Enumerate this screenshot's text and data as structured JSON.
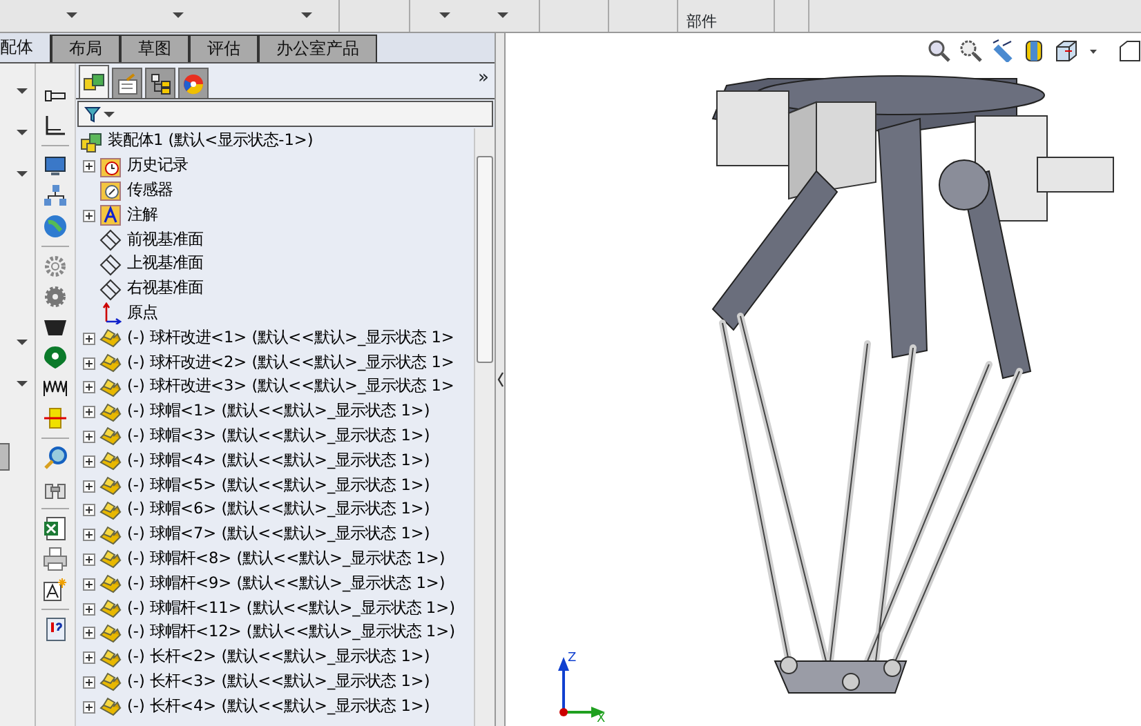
{
  "top_toolbar": {
    "label": "部件"
  },
  "tabs": [
    {
      "label": "配体",
      "selected": true
    },
    {
      "label": "布局",
      "selected": false
    },
    {
      "label": "草图",
      "selected": false
    },
    {
      "label": "评估",
      "selected": false
    },
    {
      "label": "办公室产品",
      "selected": false
    }
  ],
  "panel_tabs": [
    {
      "kind": "tree",
      "selected": true
    },
    {
      "kind": "property",
      "selected": false
    },
    {
      "kind": "config",
      "selected": false
    },
    {
      "kind": "appearance",
      "selected": false
    }
  ],
  "panel_more": "»",
  "tree": {
    "root": {
      "kind": "assembly",
      "label": "装配体1 (默认<显示状态-1>)"
    },
    "items": [
      {
        "kind": "history",
        "label": "历史记录",
        "collapsible": true
      },
      {
        "kind": "sensor",
        "label": "传感器",
        "collapsible": false
      },
      {
        "kind": "annotation",
        "label": "注解",
        "collapsible": true
      },
      {
        "kind": "plane",
        "label": "前视基准面",
        "collapsible": false
      },
      {
        "kind": "plane",
        "label": "上视基准面",
        "collapsible": false
      },
      {
        "kind": "plane",
        "label": "右视基准面",
        "collapsible": false
      },
      {
        "kind": "origin",
        "label": "原点",
        "collapsible": false
      },
      {
        "kind": "part",
        "label": "(-) 球杆改进<1> (默认<<默认>_显示状态 1>",
        "collapsible": true
      },
      {
        "kind": "part",
        "label": "(-) 球杆改进<2> (默认<<默认>_显示状态 1>",
        "collapsible": true
      },
      {
        "kind": "part",
        "label": "(-) 球杆改进<3> (默认<<默认>_显示状态 1>",
        "collapsible": true
      },
      {
        "kind": "part",
        "label": "(-) 球帽<1> (默认<<默认>_显示状态 1>)",
        "collapsible": true
      },
      {
        "kind": "part",
        "label": "(-) 球帽<3> (默认<<默认>_显示状态 1>)",
        "collapsible": true
      },
      {
        "kind": "part",
        "label": "(-) 球帽<4> (默认<<默认>_显示状态 1>)",
        "collapsible": true
      },
      {
        "kind": "part",
        "label": "(-) 球帽<5> (默认<<默认>_显示状态 1>)",
        "collapsible": true
      },
      {
        "kind": "part",
        "label": "(-) 球帽<6> (默认<<默认>_显示状态 1>)",
        "collapsible": true
      },
      {
        "kind": "part",
        "label": "(-) 球帽<7> (默认<<默认>_显示状态 1>)",
        "collapsible": true
      },
      {
        "kind": "part",
        "label": "(-) 球帽杆<8> (默认<<默认>_显示状态 1>)",
        "collapsible": true
      },
      {
        "kind": "part",
        "label": "(-) 球帽杆<9> (默认<<默认>_显示状态 1>)",
        "collapsible": true
      },
      {
        "kind": "part",
        "label": "(-) 球帽杆<11> (默认<<默认>_显示状态 1>)",
        "collapsible": true
      },
      {
        "kind": "part",
        "label": "(-) 球帽杆<12> (默认<<默认>_显示状态 1>)",
        "collapsible": true
      },
      {
        "kind": "part",
        "label": "(-) 长杆<2> (默认<<默认>_显示状态 1>)",
        "collapsible": true
      },
      {
        "kind": "part",
        "label": "(-) 长杆<3> (默认<<默认>_显示状态 1>)",
        "collapsible": true
      },
      {
        "kind": "part",
        "label": "(-) 长杆<4> (默认<<默认>_显示状态 1>)",
        "collapsible": true
      }
    ]
  },
  "triad": {
    "z": "Z",
    "x": "X"
  }
}
